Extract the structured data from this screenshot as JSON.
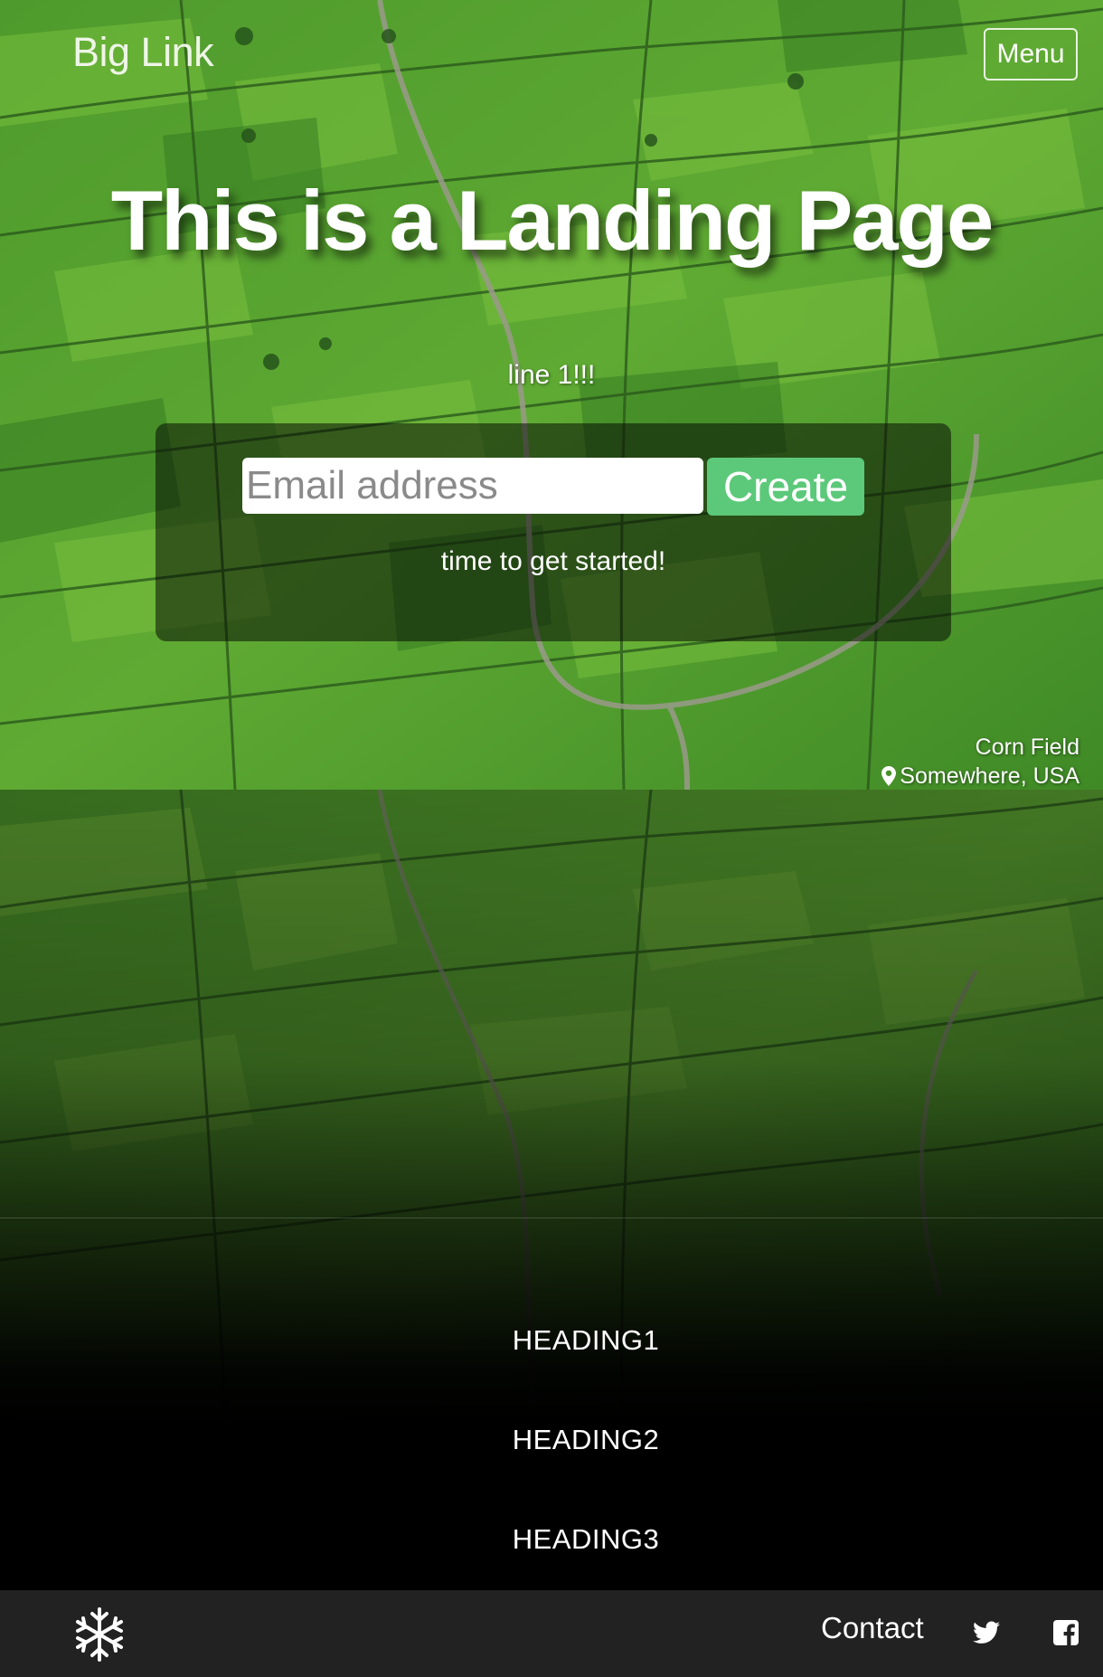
{
  "navbar": {
    "brand": "Big Link",
    "menu_label": "Menu"
  },
  "hero": {
    "title": "This is a Landing Page",
    "line1": "line 1!!!",
    "email_placeholder": "Email address",
    "create_label": "Create",
    "note": "time to get started!",
    "caption_title": "Corn Field",
    "caption_location": "Somewhere, USA",
    "caption_icon": "map-marker-icon"
  },
  "headings": [
    "HEADING1",
    "HEADING2",
    "HEADING3"
  ],
  "footer": {
    "logo_icon": "snowflake-icon",
    "contact_label": "Contact",
    "social_icons": [
      "twitter-icon",
      "facebook-icon"
    ]
  },
  "colors": {
    "accent": "#5cc97a",
    "footer_bg": "#222222",
    "field_green": "#4a9a2e"
  }
}
